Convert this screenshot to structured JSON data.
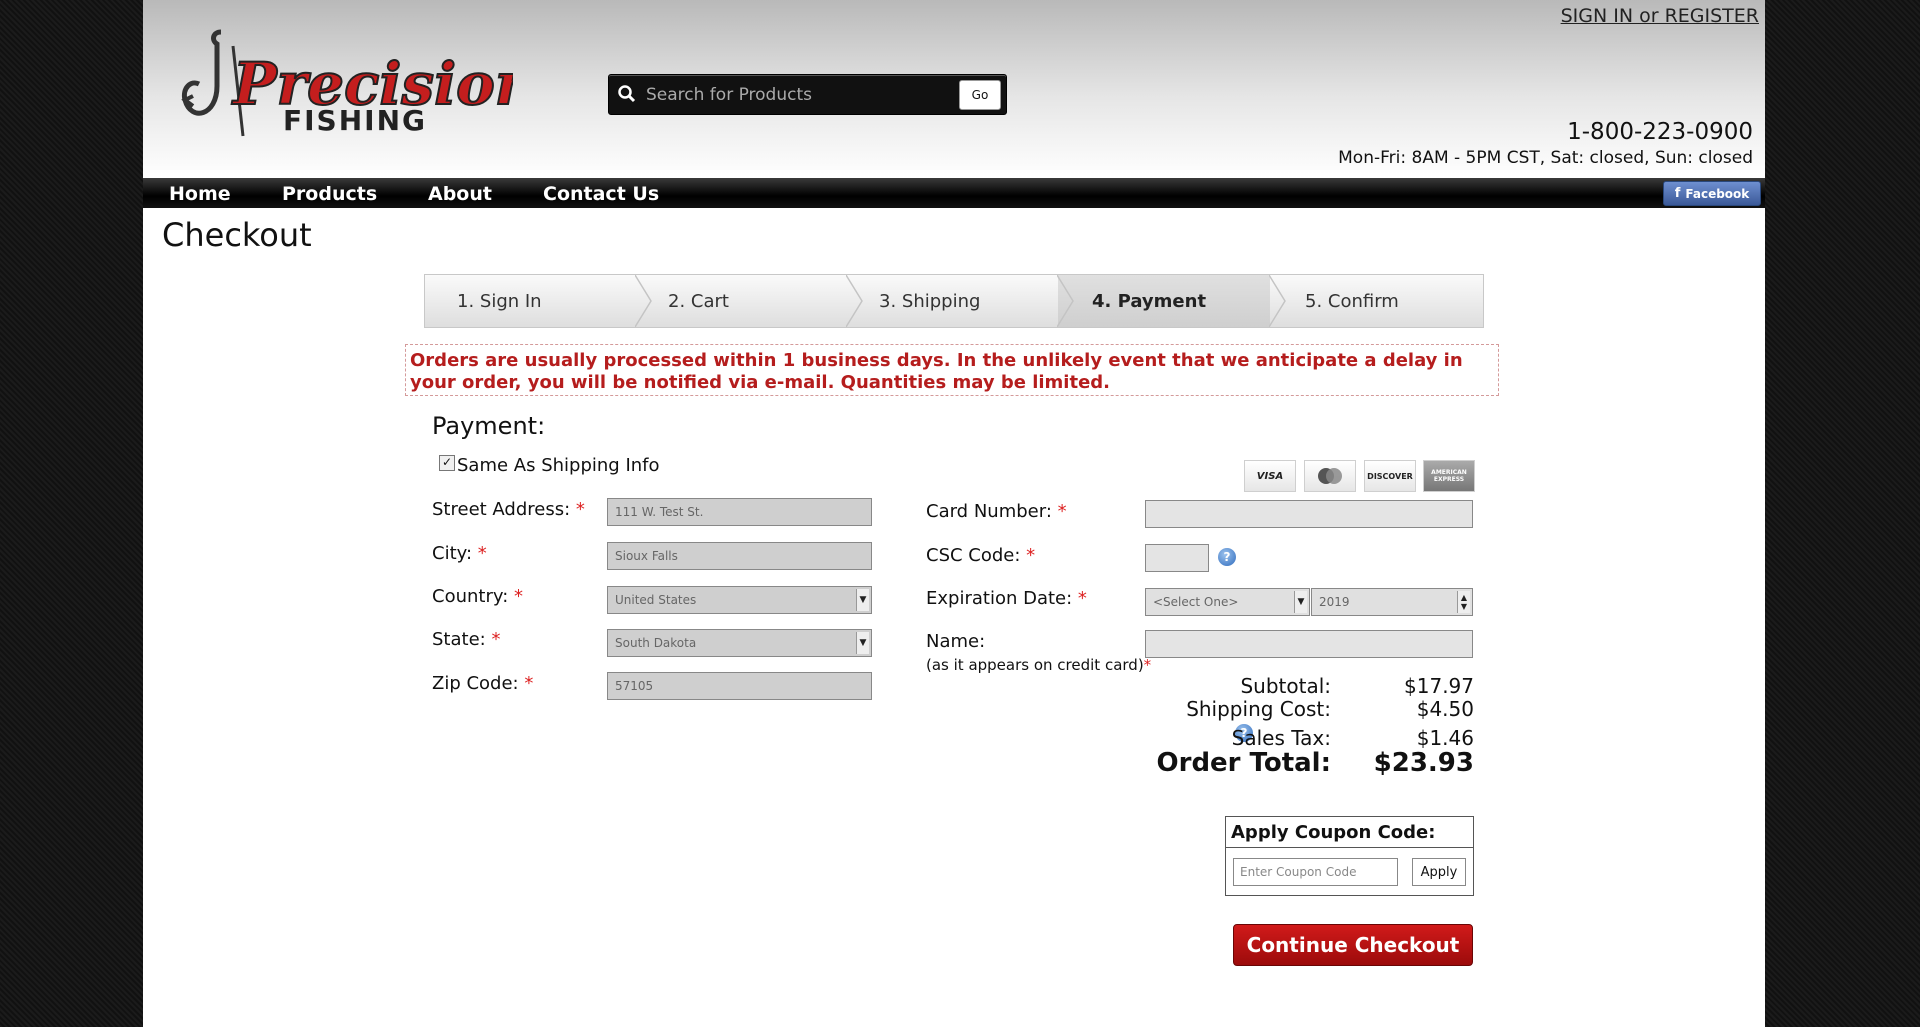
{
  "header": {
    "signin_label": "SIGN IN or REGISTER",
    "logo_text": "Precision",
    "logo_subtext": "FISHING",
    "search_placeholder": "Search for Products",
    "search_button": "Go",
    "phone": "1-800-223-0900",
    "hours": "Mon-Fri: 8AM - 5PM CST, Sat: closed, Sun: closed"
  },
  "nav": {
    "items": [
      "Home",
      "Products",
      "About",
      "Contact Us"
    ],
    "facebook_label": "Facebook"
  },
  "page_title": "Checkout",
  "steps": [
    "1. Sign In",
    "2. Cart",
    "3. Shipping",
    "4. Payment",
    "5. Confirm"
  ],
  "active_step": "4. Payment",
  "notice": "Orders are usually processed within 1 business days. In the unlikely event that we anticipate a delay in your order, you will be notified via e-mail. Quantities may be limited.",
  "payment": {
    "heading": "Payment:",
    "same_as_shipping": "Same As Shipping Info",
    "same_as_shipping_checked": true,
    "street_label": "Street Address:",
    "street_value": "111 W. Test St.",
    "city_label": "City:",
    "city_value": "Sioux Falls",
    "country_label": "Country:",
    "country_value": "United States",
    "state_label": "State:",
    "state_value": "South Dakota",
    "zip_label": "Zip Code:",
    "zip_value": "57105",
    "required_mark": "*",
    "card_number_label": "Card Number:",
    "csc_label": "CSC Code:",
    "expiration_label": "Expiration Date:",
    "expiration_month": "<Select One>",
    "expiration_year": "2019",
    "name_label": "Name:",
    "name_sublabel": "(as it appears on credit card)",
    "cards": [
      "VISA",
      "MasterCard",
      "DISCOVER",
      "AMERICAN EXPRESS"
    ]
  },
  "totals": {
    "subtotal_label": "Subtotal:",
    "subtotal_value": "$17.97",
    "shipping_label": "Shipping Cost:",
    "shipping_value": "$4.50",
    "tax_label": "Sales Tax:",
    "tax_value": "$1.46",
    "order_total_label": "Order Total:",
    "order_total_value": "$23.93"
  },
  "coupon": {
    "title": "Apply Coupon Code:",
    "placeholder": "Enter Coupon Code",
    "apply_label": "Apply"
  },
  "continue_label": "Continue Checkout",
  "colors": {
    "brand_red": "#b51d1d",
    "button_red": "#c01212",
    "nav_black": "#000000",
    "facebook_blue": "#3b5998"
  }
}
